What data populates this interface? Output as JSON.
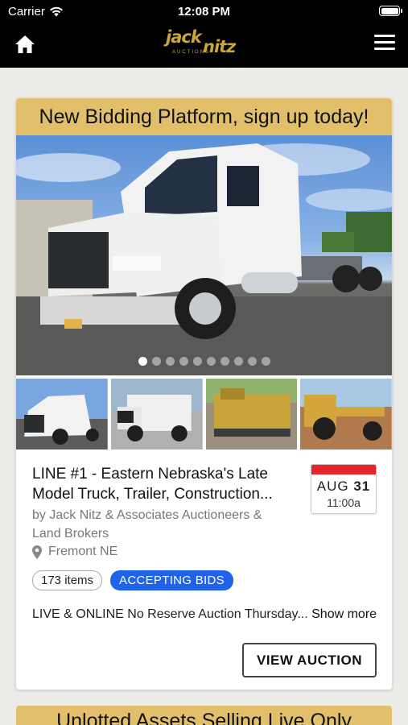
{
  "status_bar": {
    "carrier": "Carrier",
    "time": "12:08 PM"
  },
  "header": {
    "logo_top": "jack",
    "logo_bottom": "nitz",
    "logo_sub": "AUCTIONS"
  },
  "card": {
    "banner": "New Bidding Platform, sign up today!",
    "carousel": {
      "total_slides": 10,
      "active_index": 0
    },
    "title": "LINE #1 - Eastern Nebraska's Late Model Truck, Trailer, Construction...",
    "byline": "by Jack Nitz & Associates Auctioneers & Land Brokers",
    "location": "Fremont NE",
    "date": {
      "month": "AUG",
      "day": "31",
      "time": "11:00a"
    },
    "item_count": "173 items",
    "status": "ACCEPTING BIDS",
    "description": "LIVE & ONLINE No Reserve Auction Thursday...",
    "show_more": "Show more",
    "view_button": "VIEW AUCTION"
  },
  "next_card": {
    "banner": "Unlotted Assets Selling Live Only"
  },
  "colors": {
    "banner": "#e2c06b",
    "status_badge": "#1e63e9",
    "date_accent": "#e5242c",
    "logo_gold": "#c9a63a"
  },
  "icons": [
    "wifi-icon",
    "battery-icon",
    "home-icon",
    "hamburger-menu-icon",
    "location-pin-icon"
  ]
}
